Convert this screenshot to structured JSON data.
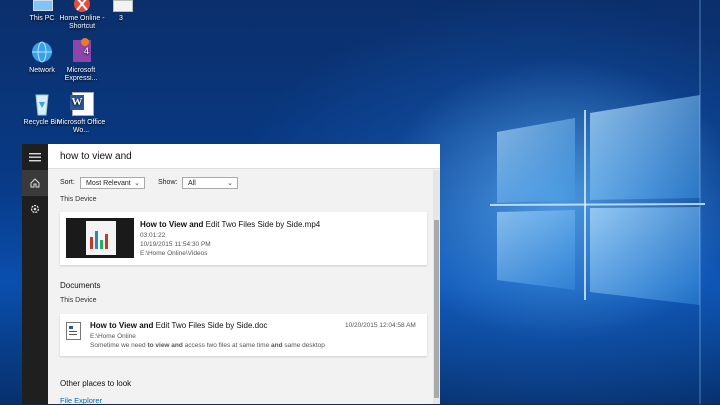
{
  "desktop_icons": [
    {
      "label": "This PC",
      "icon": "computer-icon"
    },
    {
      "label": "Home Online - Shortcut",
      "icon": "shortcut-icon"
    },
    {
      "label": "3",
      "icon": "folder-icon"
    },
    {
      "label": "Network",
      "icon": "network-icon"
    },
    {
      "label": "Microsoft Expressi...",
      "icon": "expression-icon"
    },
    {
      "label": "Recycle Bin",
      "icon": "recycle-bin-icon"
    },
    {
      "label": "Microsoft Office Wo...",
      "icon": "word-icon"
    }
  ],
  "start": {
    "rail": {
      "menu_icon": "hamburger-icon",
      "home_icon": "home-icon",
      "settings_icon": "gear-icon"
    },
    "search_query": "how to view and",
    "filters": {
      "sort_label": "Sort:",
      "sort_value": "Most Relevant",
      "show_label": "Show:",
      "show_value": "All"
    },
    "videos": {
      "section_sub": "This Device",
      "item": {
        "title_bold": "How to View and",
        "title_rest": " Edit Two Files Side by Side.mp4",
        "duration": "03:01:22",
        "date": "10/19/2015 11:54:30 PM",
        "path": "E:\\Home Online\\Videos"
      }
    },
    "documents": {
      "header": "Documents",
      "section_sub": "This Device",
      "item": {
        "title_bold": "How to View and",
        "title_rest": " Edit Two Files Side by Side.doc",
        "date": "10/20/2015 12:04:58 AM",
        "path": "E:\\Home Online",
        "snippet_a": "Sometime we need ",
        "snippet_b": "to view and",
        "snippet_c": " access two files at same time ",
        "snippet_d": "and",
        "snippet_e": " same desktop"
      }
    },
    "other": {
      "header": "Other places to look",
      "link": "File Explorer"
    }
  },
  "colors": {
    "accent": "#0067b8",
    "panel": "#f2f2f2",
    "rail": "#1f1f1f"
  }
}
